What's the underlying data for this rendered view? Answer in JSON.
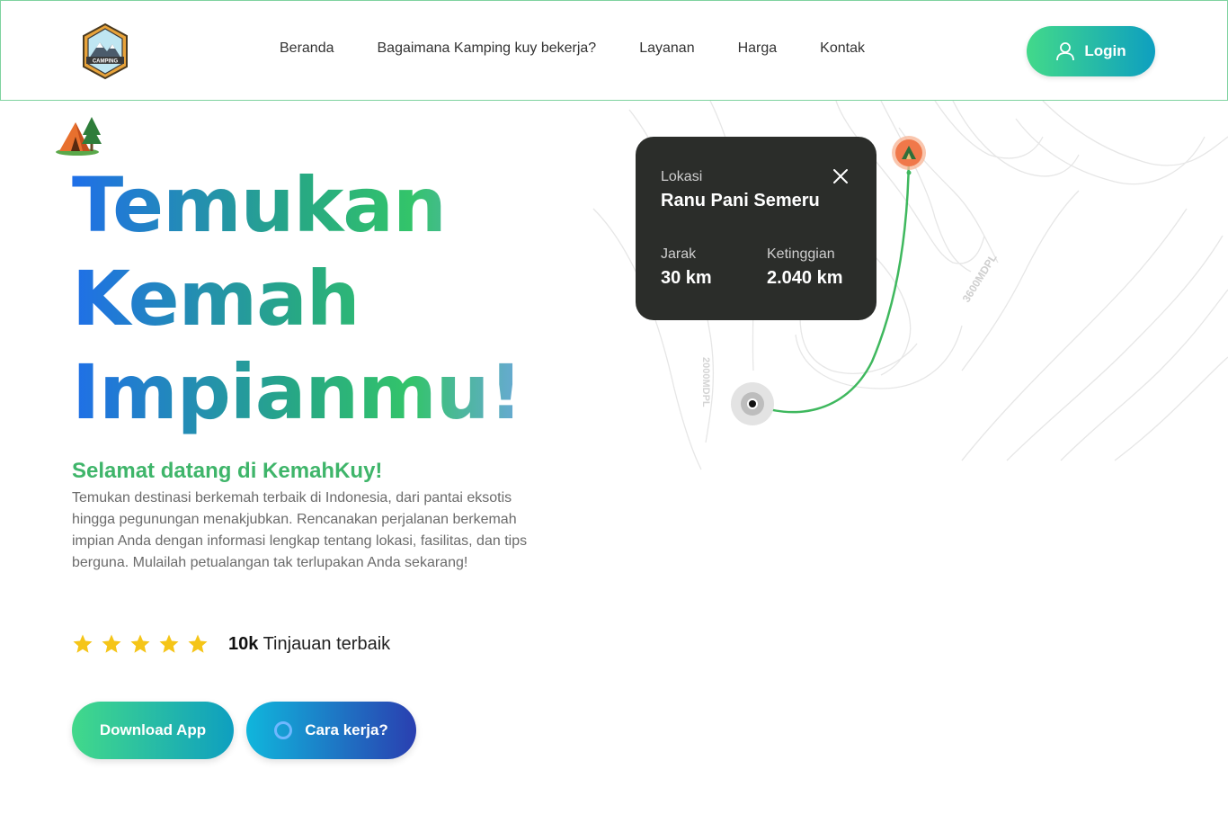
{
  "header": {
    "logo_text": "CAMPING",
    "nav": [
      "Beranda",
      "Bagaimana Kamping kuy bekerja?",
      "Layanan",
      "Harga",
      "Kontak"
    ],
    "login_label": "Login"
  },
  "hero": {
    "title_lines": [
      "Temukan",
      "Kemah",
      "Impianmu!"
    ],
    "welcome": "Selamat datang di KemahKuy!",
    "description": "Temukan destinasi berkemah terbaik di Indonesia, dari pantai eksotis hingga pegunungan menakjubkan. Rencanakan perjalanan berkemah impian Anda dengan informasi lengkap tentang lokasi, fasilitas, dan tips berguna. Mulailah petualangan tak terlupakan Anda sekarang!",
    "rating": {
      "stars": 5,
      "count": "10k",
      "label": "Tinjauan terbaik"
    },
    "download_label": "Download App",
    "how_label": "Cara kerja?"
  },
  "map": {
    "contour_labels": [
      "3600MDPL",
      "2000MDPL"
    ],
    "card": {
      "location_label": "Lokasi",
      "location_value": "Ranu Pani Semeru",
      "distance_label": "Jarak",
      "distance_value": "30 km",
      "altitude_label": "Ketinggian",
      "altitude_value": "2.040 km"
    }
  },
  "colors": {
    "accent_green": "#42d98a",
    "accent_teal": "#0e9fc0",
    "accent_blue": "#2a3fb0",
    "card_bg": "#2b2d2a",
    "welcome_green": "#3fb56a"
  }
}
